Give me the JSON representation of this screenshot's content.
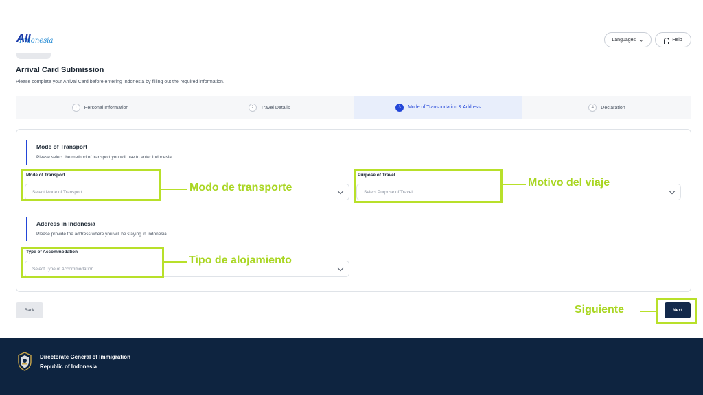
{
  "header": {
    "logo_main": "All",
    "logo_sub": "Indonesia",
    "languages_label": "Languages",
    "help_label": "Help"
  },
  "page": {
    "title": "Arrival Card Submission",
    "subtitle": "Please complete your Arrival Card before entering Indonesia by filling out the required information."
  },
  "stepper": {
    "steps": [
      {
        "num": "1",
        "label": "Personal Information",
        "active": false
      },
      {
        "num": "2",
        "label": "Travel Details",
        "active": false
      },
      {
        "num": "3",
        "label": "Mode of Transportation & Address",
        "active": true
      },
      {
        "num": "4",
        "label": "Declaration",
        "active": false
      }
    ]
  },
  "form": {
    "transport_section": {
      "title": "Mode of Transport",
      "description": "Please select the method of transport you will use to enter Indonesia."
    },
    "mode_of_transport": {
      "label": "Mode of Transport",
      "placeholder": "Select Mode of Transport"
    },
    "purpose_of_travel": {
      "label": "Purpose of Travel",
      "placeholder": "Select Purpose of Travel"
    },
    "address_section": {
      "title": "Address in Indonesia",
      "description": "Please provide the address where you will be staying in Indonesia"
    },
    "type_of_accommodation": {
      "label": "Type of Accommodation",
      "placeholder": "Select Type of Accommodation"
    }
  },
  "annotations": {
    "mode_of_transport": "Modo de transporte",
    "purpose_of_travel": "Motivo del viaje",
    "accommodation": "Tipo de alojamiento",
    "next": "Siguiente",
    "color": "#b8e02a"
  },
  "buttons": {
    "back": "Back",
    "next": "Next"
  },
  "footer": {
    "line1": "Directorate General of Immigration",
    "line2": "Republic of Indonesia"
  },
  "colors": {
    "primary": "#2346d8",
    "navy": "#13294b",
    "footer_bg": "#0e2440"
  }
}
